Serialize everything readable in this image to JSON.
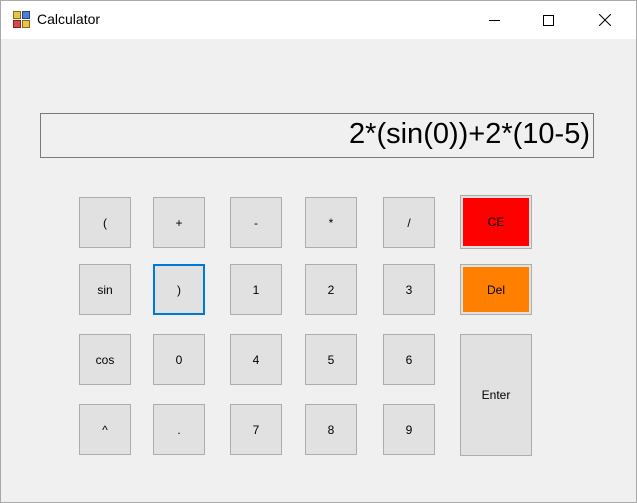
{
  "window": {
    "title": "Calculator",
    "icon": "calculator-app-icon"
  },
  "display": {
    "text": "2*(sin(0))+2*(10-5)"
  },
  "keys": {
    "lparen": "(",
    "plus": "+",
    "minus": "-",
    "multiply": "*",
    "divide": "/",
    "ce": "CE",
    "sin": "sin",
    "rparen": ")",
    "k1": "1",
    "k2": "2",
    "k3": "3",
    "del": "Del",
    "cos": "cos",
    "k0": "0",
    "k4": "4",
    "k5": "5",
    "k6": "6",
    "enter": "Enter",
    "power": "^",
    "dot": ".",
    "k7": "7",
    "k8": "8",
    "k9": "9"
  },
  "colors": {
    "ce": "#ff0000",
    "del": "#ff8000",
    "focus": "#0078d7"
  }
}
